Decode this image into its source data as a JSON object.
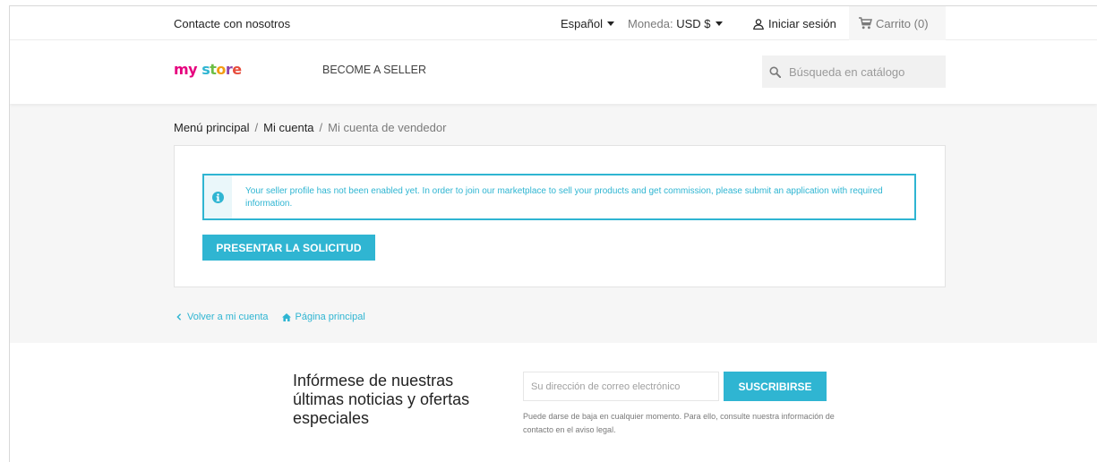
{
  "topbar": {
    "contact_label": "Contacte con nosotros",
    "language_label": "Español",
    "currency_prefix": "Moneda:",
    "currency_value": "USD $",
    "signin_label": "Iniciar sesión",
    "cart_label": "Carrito",
    "cart_count": "(0)"
  },
  "header": {
    "logo_text": [
      "m",
      "y",
      " ",
      "s",
      "t",
      "o",
      "r",
      "e"
    ],
    "nav_seller_label": "BECOME A SELLER",
    "search_placeholder": "Búsqueda en catálogo"
  },
  "breadcrumb": {
    "items": [
      "Menú principal",
      "Mi cuenta",
      "Mi cuenta de vendedor"
    ],
    "separator": "/"
  },
  "alert": {
    "message": "Your seller profile has not been enabled yet. In order to join our marketplace to sell your products and get commission, please submit an application with required information."
  },
  "apply_button_label": "PRESENTAR LA SOLICITUD",
  "footer_links": {
    "back_label": "Volver a mi cuenta",
    "home_label": "Página principal"
  },
  "newsletter": {
    "title": "Infórmese de nuestras últimas noticias y ofertas especiales",
    "email_placeholder": "Su dirección de correo electrónico",
    "subscribe_label": "SUSCRIBIRSE",
    "note": "Puede darse de baja en cualquier momento. Para ello, consulte nuestra información de contacto en el aviso legal."
  },
  "colors": {
    "accent": "#2fb5d2",
    "logo": [
      "#e6007e",
      "#e6007e",
      "#ffffff",
      "#2fb5d2",
      "#6cbe45",
      "#f39c12",
      "#8e44ad",
      "#e74c3c"
    ]
  },
  "icons": {
    "user": "user-icon",
    "cart": "cart-icon",
    "search": "search-icon",
    "info": "info-icon",
    "back": "chevron-left-icon",
    "home": "home-icon"
  }
}
